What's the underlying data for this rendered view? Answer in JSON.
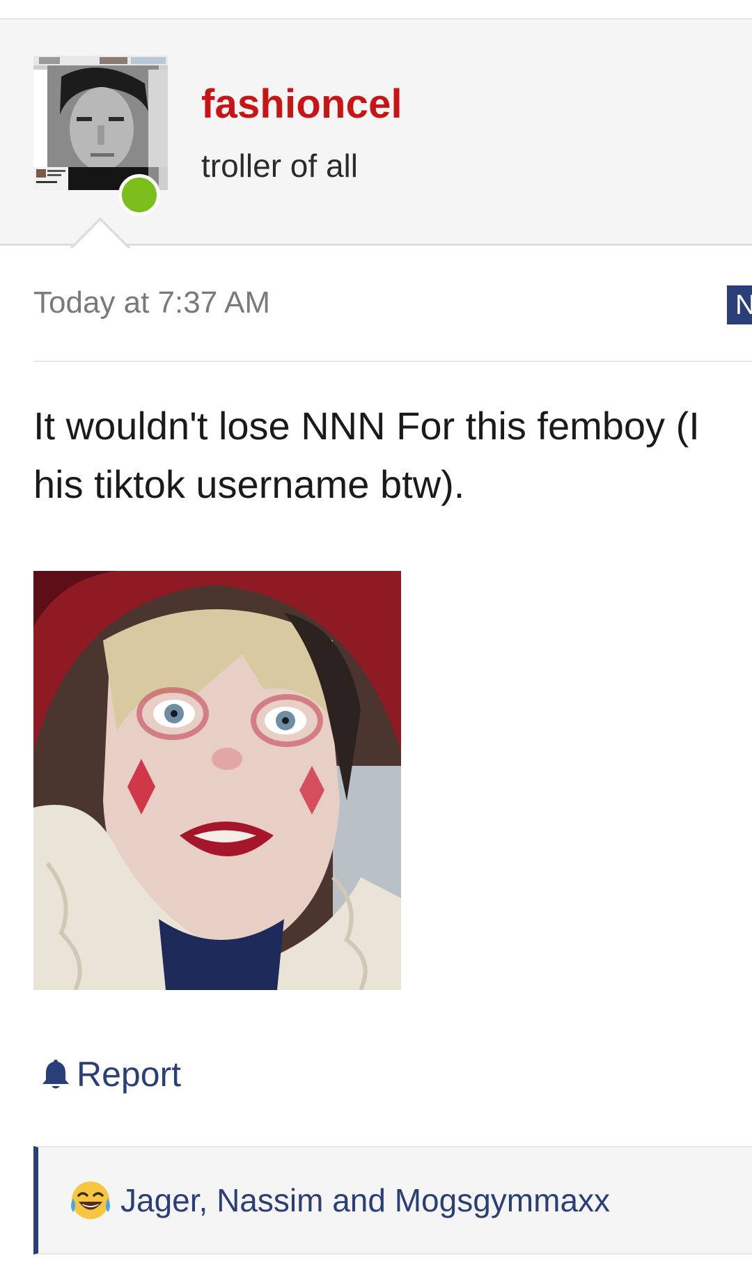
{
  "user": {
    "username": "fashioncel",
    "title": "troller of all",
    "status": "online"
  },
  "post": {
    "timestamp": "Today at 7:37 AM",
    "badge_text": "N",
    "body_line_1": "It wouldn't lose NNN For this femboy (I",
    "body_line_2": "his tiktok username btw)."
  },
  "actions": {
    "report_label": "Report"
  },
  "reactions": {
    "users_text": "Jager, Nassim and Mogsgymmaxx"
  },
  "colors": {
    "username": "#c81414",
    "accent": "#2a3f78",
    "online": "#7cbf1c",
    "header_bg": "#f6f5f5"
  },
  "icons": {
    "report": "bell-icon",
    "reaction": "laughing-crying-face-icon"
  }
}
